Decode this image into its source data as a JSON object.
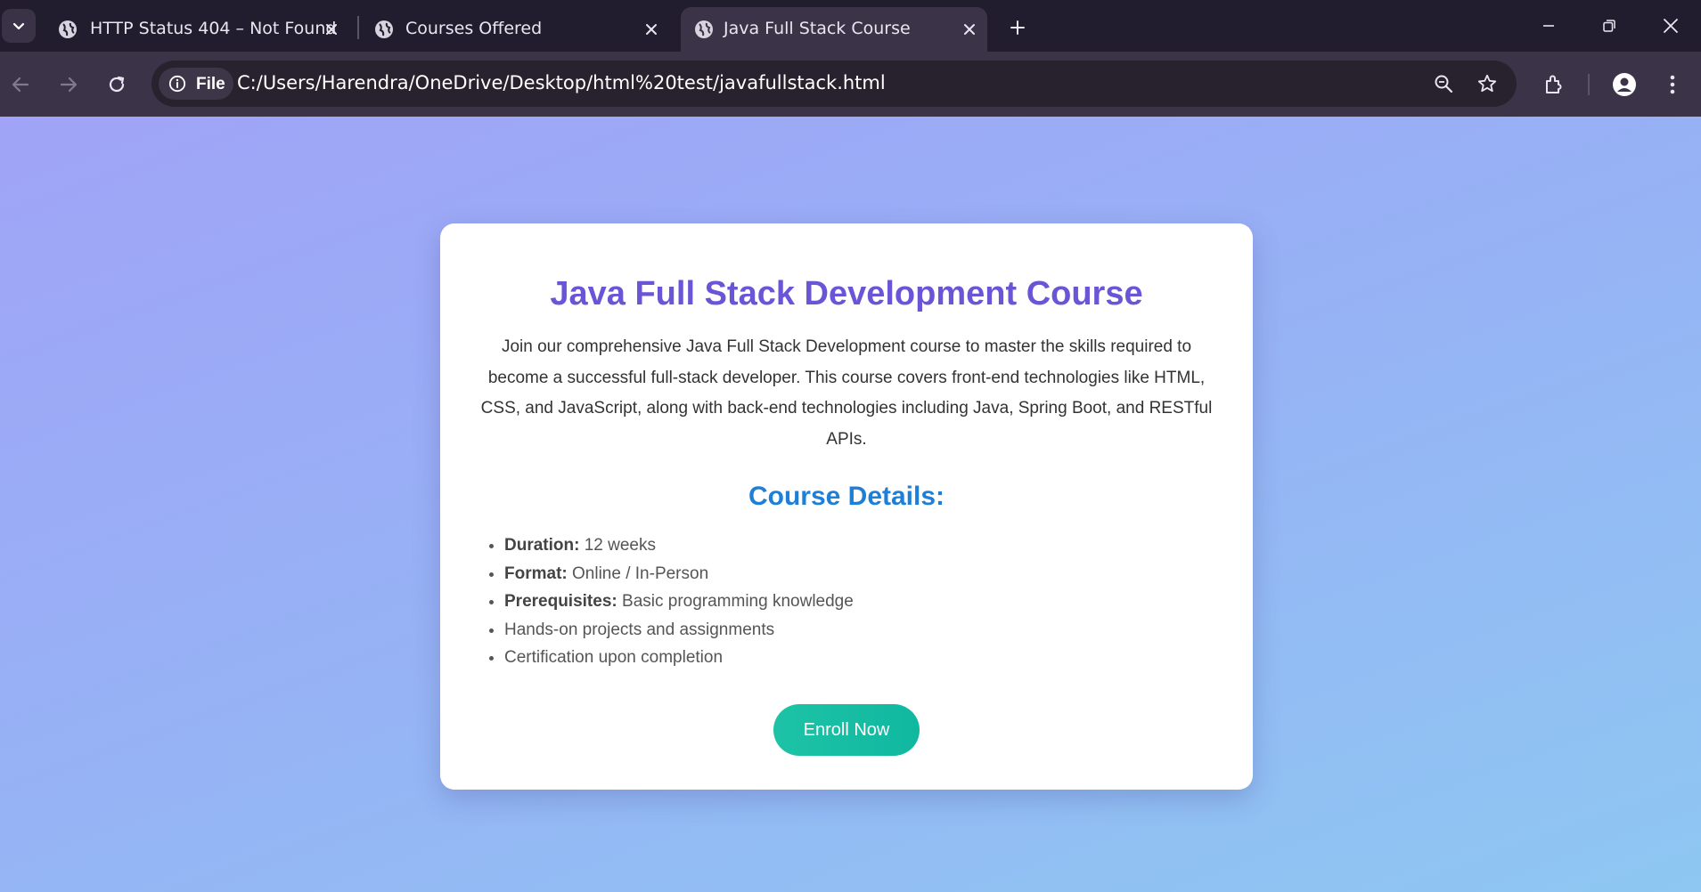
{
  "browser": {
    "tabs": [
      {
        "title": "HTTP Status 404 – Not Found",
        "active": false
      },
      {
        "title": "Courses Offered",
        "active": false
      },
      {
        "title": "Java Full Stack Course",
        "active": true
      }
    ],
    "address_chip_label": "File",
    "url": "C:/Users/Harendra/OneDrive/Desktop/html%20test/javafullstack.html"
  },
  "page": {
    "title": "Java Full Stack Development Course",
    "description": "Join our comprehensive Java Full Stack Development course to master the skills required to become a successful full-stack developer. This course covers front-end technologies like HTML, CSS, and JavaScript, along with back-end technologies including Java, Spring Boot, and RESTful APIs.",
    "details_heading": "Course Details:",
    "details": [
      {
        "label": "Duration:",
        "value": "12 weeks"
      },
      {
        "label": "Format:",
        "value": "Online / In-Person"
      },
      {
        "label": "Prerequisites:",
        "value": "Basic programming knowledge"
      },
      {
        "label": "",
        "value": "Hands-on projects and assignments"
      },
      {
        "label": "",
        "value": "Certification upon completion"
      }
    ],
    "enroll_label": "Enroll Now"
  },
  "colors": {
    "title": "#6a55d6",
    "heading": "#1e7fd8",
    "button": "#1ec3a6",
    "tab_strip": "#221d2e",
    "toolbar": "#3b3448"
  },
  "icons": [
    "tab-search-icon",
    "globe-icon",
    "close-icon",
    "plus-icon",
    "minimize-icon",
    "restore-icon",
    "back-icon",
    "forward-icon",
    "reload-icon",
    "info-icon",
    "zoom-icon",
    "star-icon",
    "extensions-icon",
    "profile-icon",
    "menu-icon"
  ]
}
